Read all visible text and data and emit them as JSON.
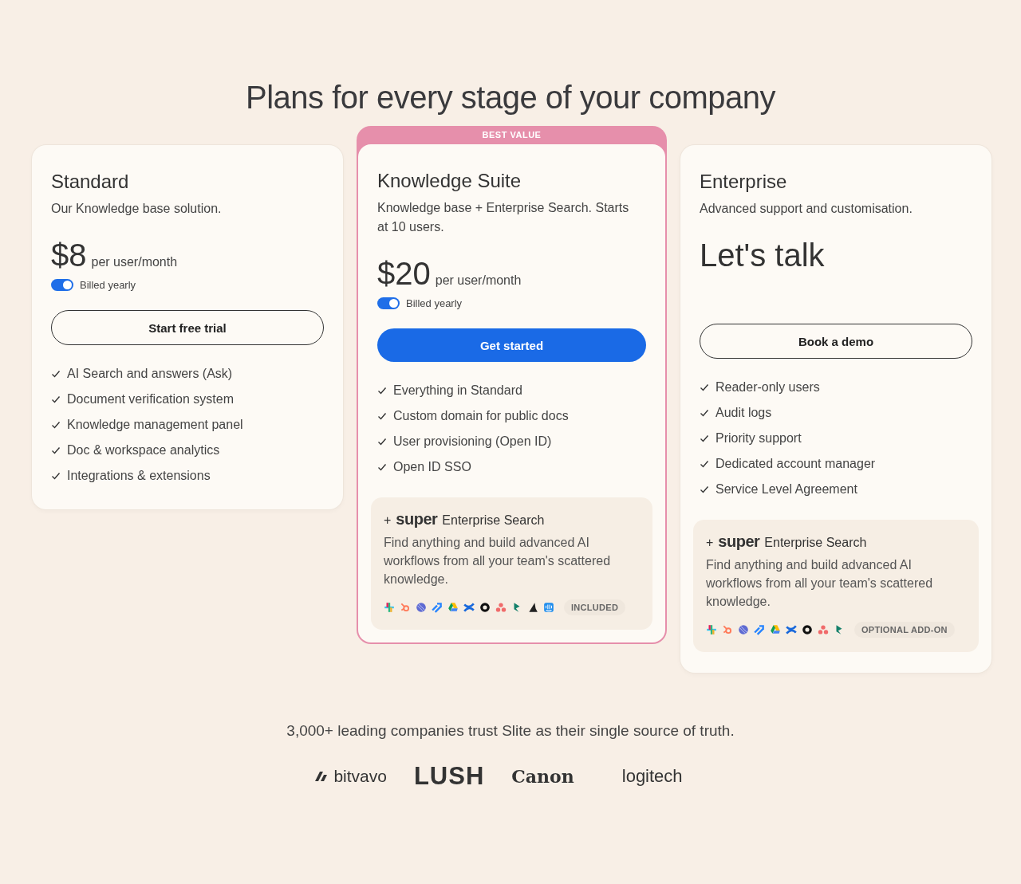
{
  "heading": "Plans for every stage of your company",
  "plans": [
    {
      "name": "Standard",
      "description": "Our Knowledge base solution.",
      "price": "$8",
      "price_unit": "per user/month",
      "billing": {
        "label": "Billed yearly",
        "on": true
      },
      "button": {
        "label": "Start free trial",
        "kind": "outline"
      },
      "features": [
        "AI Search and answers (Ask)",
        "Document verification system",
        "Knowledge management panel",
        "Doc & workspace analytics",
        "Integrations & extensions"
      ],
      "highlighted": false
    },
    {
      "name": "Knowledge Suite",
      "ribbon": "BEST VALUE",
      "description": "Knowledge base + Enterprise Search. Starts at 10 users.",
      "price": "$20",
      "price_unit": "per user/month",
      "billing": {
        "label": "Billed yearly",
        "on": true
      },
      "button": {
        "label": "Get started",
        "kind": "primary"
      },
      "features": [
        "Everything in Standard",
        "Custom domain for public docs",
        "User provisioning (Open ID)",
        "Open ID SSO"
      ],
      "highlighted": true,
      "addon": {
        "plus": "+",
        "logo": "super",
        "title": "Enterprise Search",
        "text": "Find anything and build advanced AI workflows from all your team's scattered knowledge.",
        "badge": "INCLUDED"
      }
    },
    {
      "name": "Enterprise",
      "description": "Advanced support and customisation.",
      "price": "Let's talk",
      "button": {
        "label": "Book a demo",
        "kind": "outline"
      },
      "features": [
        "Reader-only users",
        "Audit logs",
        "Priority support",
        "Dedicated account manager",
        "Service Level Agreement"
      ],
      "highlighted": false,
      "addon": {
        "plus": "+",
        "logo": "super",
        "title": "Enterprise Search",
        "text": "Find anything and build advanced AI workflows from all your team's scattered knowledge.",
        "badge": "OPTIONAL ADD-ON"
      }
    }
  ],
  "trust": {
    "text": "3,000+ leading companies trust Slite as their single source of truth.",
    "logos": [
      {
        "name": "bitvavo",
        "kind": "bitvavo"
      },
      {
        "name": "LUSH",
        "kind": "lush"
      },
      {
        "name": "Canon",
        "kind": "canon"
      },
      {
        "name": "logitech",
        "kind": "logitech"
      }
    ]
  }
}
